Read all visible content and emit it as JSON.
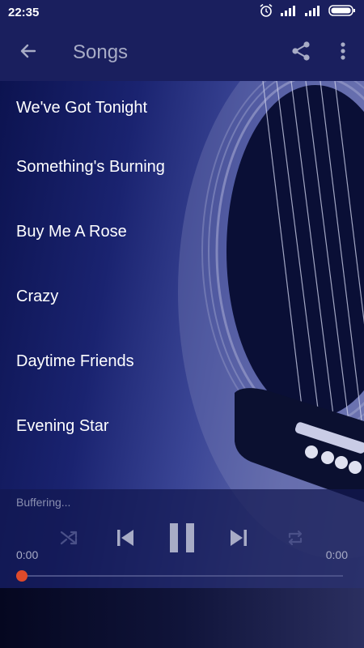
{
  "status_bar": {
    "time": "22:35"
  },
  "app_bar": {
    "title": "Songs"
  },
  "songs": [
    "We've Got Tonight",
    "Something's Burning",
    "Buy Me A Rose",
    "Crazy",
    "Daytime Friends",
    "Evening Star"
  ],
  "player": {
    "status": "Buffering...",
    "elapsed": "0:00",
    "duration": "0:00",
    "progress": 0,
    "is_playing": true
  },
  "colors": {
    "appbar": "#1a1f5e",
    "accent": "#e04a2a",
    "control_active": "#a8acc6",
    "control_inactive": "#4a5088"
  }
}
